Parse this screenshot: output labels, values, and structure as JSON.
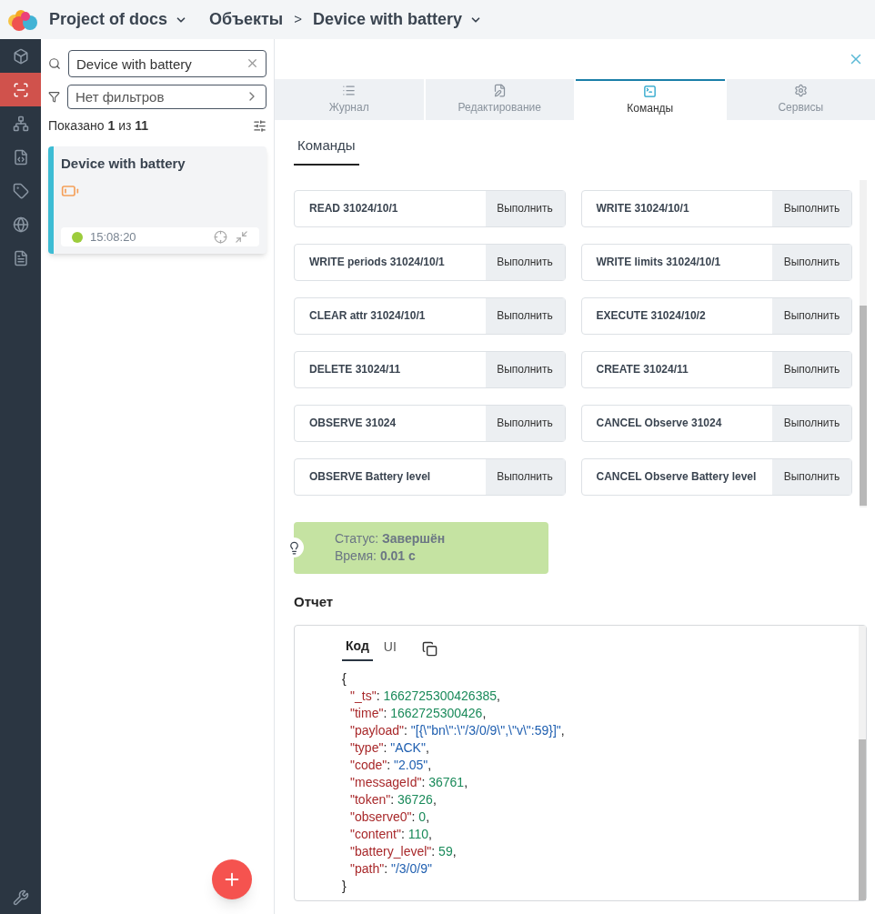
{
  "header": {
    "project": "Project of docs",
    "section": "Объекты",
    "separator": ">",
    "object": "Device with battery"
  },
  "rail": [
    {
      "kind": "cube",
      "selected": false
    },
    {
      "kind": "target",
      "selected": true
    },
    {
      "kind": "tree",
      "selected": false
    },
    {
      "kind": "code",
      "selected": false
    },
    {
      "kind": "tag",
      "selected": false
    },
    {
      "kind": "globe",
      "selected": false
    },
    {
      "kind": "doc",
      "selected": false
    }
  ],
  "rail_bottom": {
    "kind": "tools"
  },
  "search": {
    "value": "Device with battery"
  },
  "filter": {
    "placeholder": "Нет фильтров"
  },
  "shown": "Показано **1** из **11**",
  "devices": [
    {
      "name": "Device with battery",
      "time": "15:08:20",
      "online": true,
      "selected": true
    }
  ],
  "tabs": [
    {
      "label": "Журнал",
      "kind": "list",
      "selected": false
    },
    {
      "label": "Редактирование",
      "kind": "edit",
      "selected": false
    },
    {
      "label": "Команды",
      "kind": "terminal",
      "selected": true
    },
    {
      "label": "Сервисы",
      "kind": "gear",
      "selected": false
    }
  ],
  "subtab": {
    "label": "Команды",
    "selected": true
  },
  "commands": [
    {
      "name": "READ 31024/10/1",
      "action": "Выполнить"
    },
    {
      "name": "WRITE 31024/10/1",
      "action": "Выполнить"
    },
    {
      "name": "WRITE periods 31024/10/1",
      "action": "Выполнить"
    },
    {
      "name": "WRITE limits 31024/10/1",
      "action": "Выполнить"
    },
    {
      "name": "CLEAR attr 31024/10/1",
      "action": "Выполнить"
    },
    {
      "name": "EXECUTE 31024/10/2",
      "action": "Выполнить"
    },
    {
      "name": "DELETE 31024/11",
      "action": "Выполнить"
    },
    {
      "name": "CREATE 31024/11",
      "action": "Выполнить"
    },
    {
      "name": "OBSERVE 31024",
      "action": "Выполнить"
    },
    {
      "name": "CANCEL Observe 31024",
      "action": "Выполнить"
    },
    {
      "name": "OBSERVE Battery level",
      "action": "Выполнить"
    },
    {
      "name": "CANCEL Observe Battery level",
      "action": "Выполнить"
    }
  ],
  "status": {
    "status": "Статус: **Завершён**",
    "time": "Время: **0.01 с**"
  },
  "report": {
    "title": "Отчет",
    "tabs": [
      {
        "label": "Код",
        "selected": true
      },
      {
        "label": "UI",
        "selected": false
      }
    ],
    "open": "{",
    "close": "}",
    "lines": [
      {
        "key": "\"_ts\"",
        "sep": ": ",
        "value": "1662725300426385",
        "kind": "number",
        "end": ","
      },
      {
        "key": "\"time\"",
        "sep": ": ",
        "value": "1662725300426",
        "kind": "number",
        "end": ","
      },
      {
        "key": "\"payload\"",
        "sep": ": ",
        "value": "\"[{\\\"bn\\\":\\\"/3/0/9\\\",\\\"v\\\":59}]\"",
        "kind": "string",
        "end": ","
      },
      {
        "key": "\"type\"",
        "sep": ": ",
        "value": "\"ACK\"",
        "kind": "string",
        "end": ","
      },
      {
        "key": "\"code\"",
        "sep": ": ",
        "value": "\"2.05\"",
        "kind": "string",
        "end": ","
      },
      {
        "key": "\"messageId\"",
        "sep": ": ",
        "value": "36761",
        "kind": "number",
        "end": ","
      },
      {
        "key": "\"token\"",
        "sep": ": ",
        "value": "36726",
        "kind": "number",
        "end": ","
      },
      {
        "key": "\"observe0\"",
        "sep": ": ",
        "value": "0",
        "kind": "number",
        "end": ","
      },
      {
        "key": "\"content\"",
        "sep": ": ",
        "value": "110",
        "kind": "number",
        "end": ","
      },
      {
        "key": "\"battery_level\"",
        "sep": ": ",
        "value": "59",
        "kind": "number",
        "end": ","
      },
      {
        "key": "\"path\"",
        "sep": ": ",
        "value": "\"/3/0/9\"",
        "kind": "string"
      }
    ]
  }
}
